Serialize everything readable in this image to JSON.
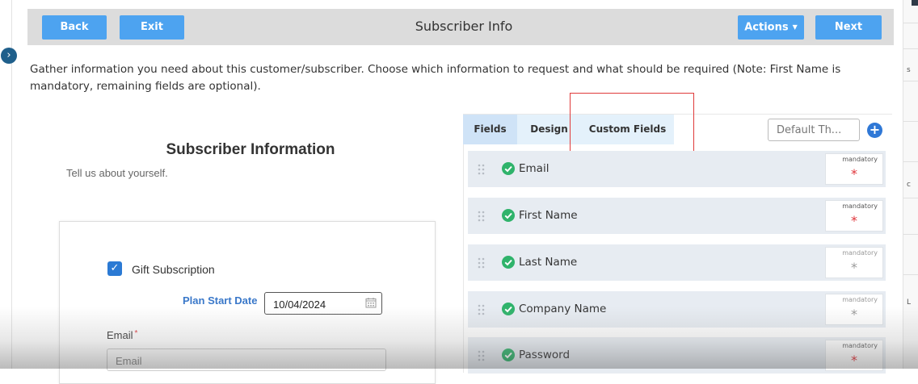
{
  "header": {
    "back_label": "Back",
    "exit_label": "Exit",
    "title": "Subscriber Info",
    "actions_label": "Actions",
    "next_label": "Next"
  },
  "intro_text": "Gather information you need about this customer/subscriber. Choose which information to request and what should be required (Note: First Name is mandatory, remaining fields are optional).",
  "preview": {
    "title": "Subscriber Information",
    "subtitle": "Tell us about yourself.",
    "gift_label": "Gift Subscription",
    "gift_checked": true,
    "plan_start_label": "Plan Start Date",
    "plan_start_value": "10/04/2024",
    "email_label": "Email",
    "email_required_mark": "*",
    "email_placeholder": "Email"
  },
  "tabs": [
    {
      "label": "Fields",
      "active": true
    },
    {
      "label": "Design",
      "active": false
    },
    {
      "label": "Custom Fields",
      "active": false
    }
  ],
  "theme_select": {
    "placeholder": "Default Th..."
  },
  "fields": [
    {
      "name": "Email",
      "mandatory_label": "mandatory",
      "star": "*",
      "mandatory": true
    },
    {
      "name": "First Name",
      "mandatory_label": "mandatory",
      "star": "*",
      "mandatory": true
    },
    {
      "name": "Last Name",
      "mandatory_label": "mandatory",
      "star": "*",
      "mandatory": false
    },
    {
      "name": "Company Name",
      "mandatory_label": "mandatory",
      "star": "*",
      "mandatory": false
    },
    {
      "name": "Password",
      "mandatory_label": "mandatory",
      "star": "*",
      "mandatory": true
    }
  ],
  "right_strip_letters": [
    "s",
    "c",
    "L"
  ],
  "colors": {
    "button_blue": "#4da3f0",
    "header_gray": "#dcdcdc",
    "row_bg": "#e7ecf2",
    "star_required": "#e0353b",
    "star_optional": "#9a9a9a",
    "check_green": "#2fb36b",
    "highlight_red": "#e03a3a"
  }
}
